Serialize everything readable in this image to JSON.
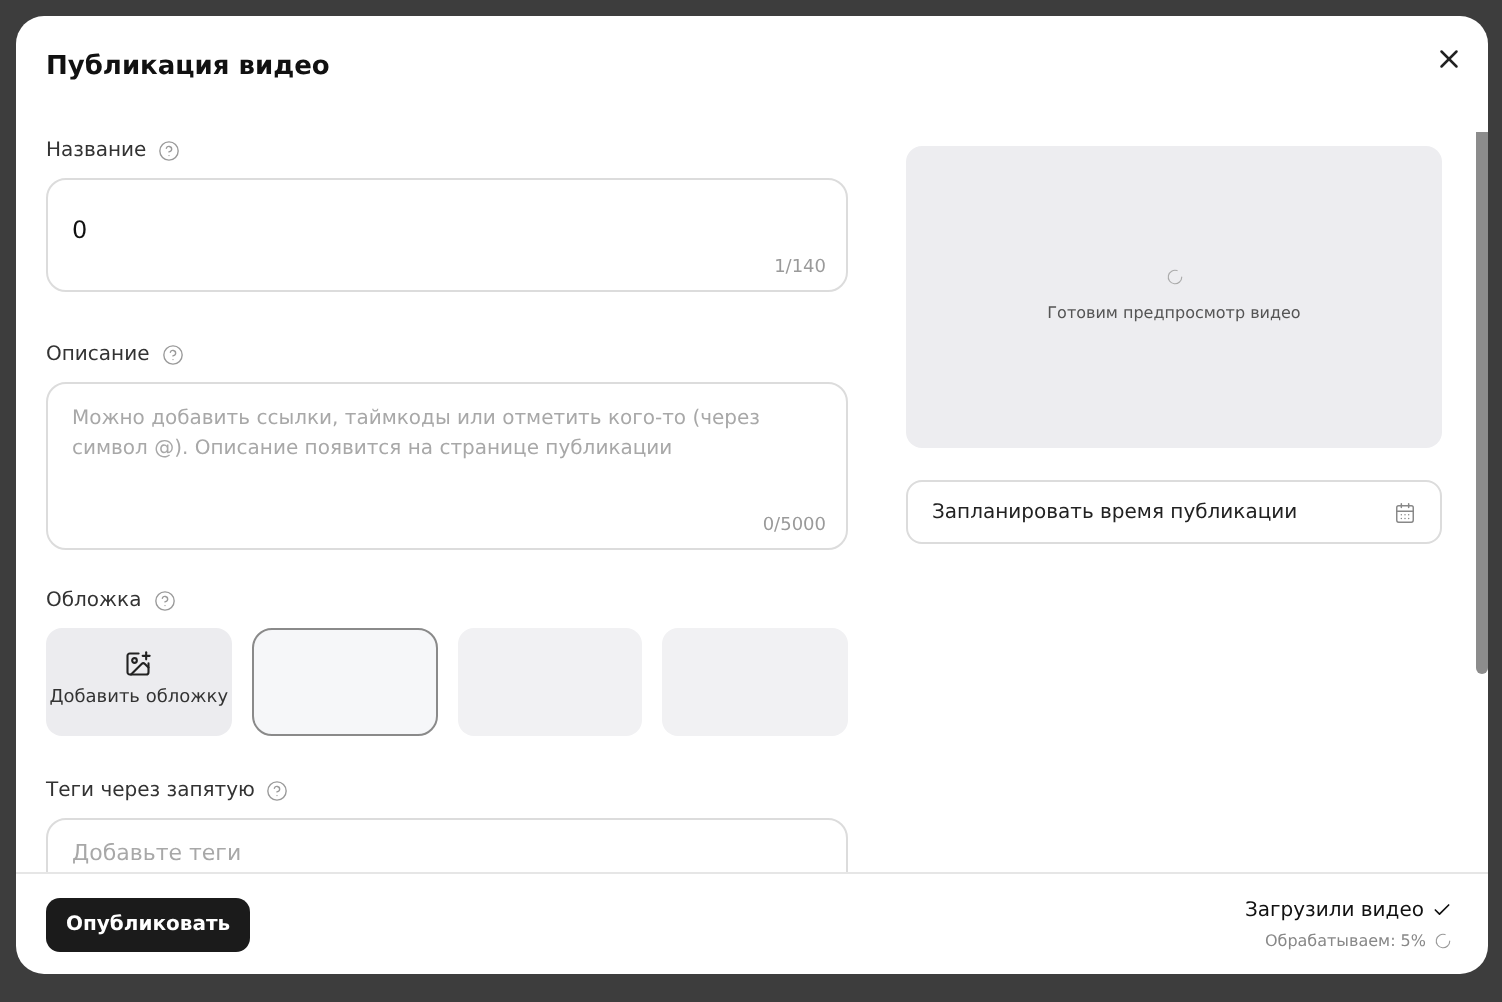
{
  "dialog": {
    "title": "Публикация видео"
  },
  "fields": [
    {
      "kind": "input",
      "label": "Название",
      "value": "0",
      "counter": "1/140"
    },
    {
      "kind": "textarea",
      "label": "Описание",
      "placeholder": "Можно добавить ссылки, таймкоды или отметить кого-то (через символ @). Описание появится на странице публикации",
      "counter": "0/5000"
    }
  ],
  "cover": {
    "label": "Обложка",
    "tiles": [
      {
        "kind": "add",
        "label": "Добавить обложку",
        "selected": false
      },
      {
        "kind": "frame",
        "selected": true
      },
      {
        "kind": "frame",
        "selected": false
      },
      {
        "kind": "frame",
        "selected": false
      }
    ]
  },
  "tags": {
    "label": "Теги через запятую",
    "placeholder": "Добавьте теги"
  },
  "preview": {
    "text": "Готовим предпросмотр видео"
  },
  "schedule": {
    "label": "Запланировать время публикации"
  },
  "footer": {
    "button": "Опубликовать",
    "status": [
      {
        "kind": "done",
        "text": "Загрузили видео"
      },
      {
        "kind": "progress",
        "text": "Обрабатываем: 5%"
      }
    ]
  }
}
